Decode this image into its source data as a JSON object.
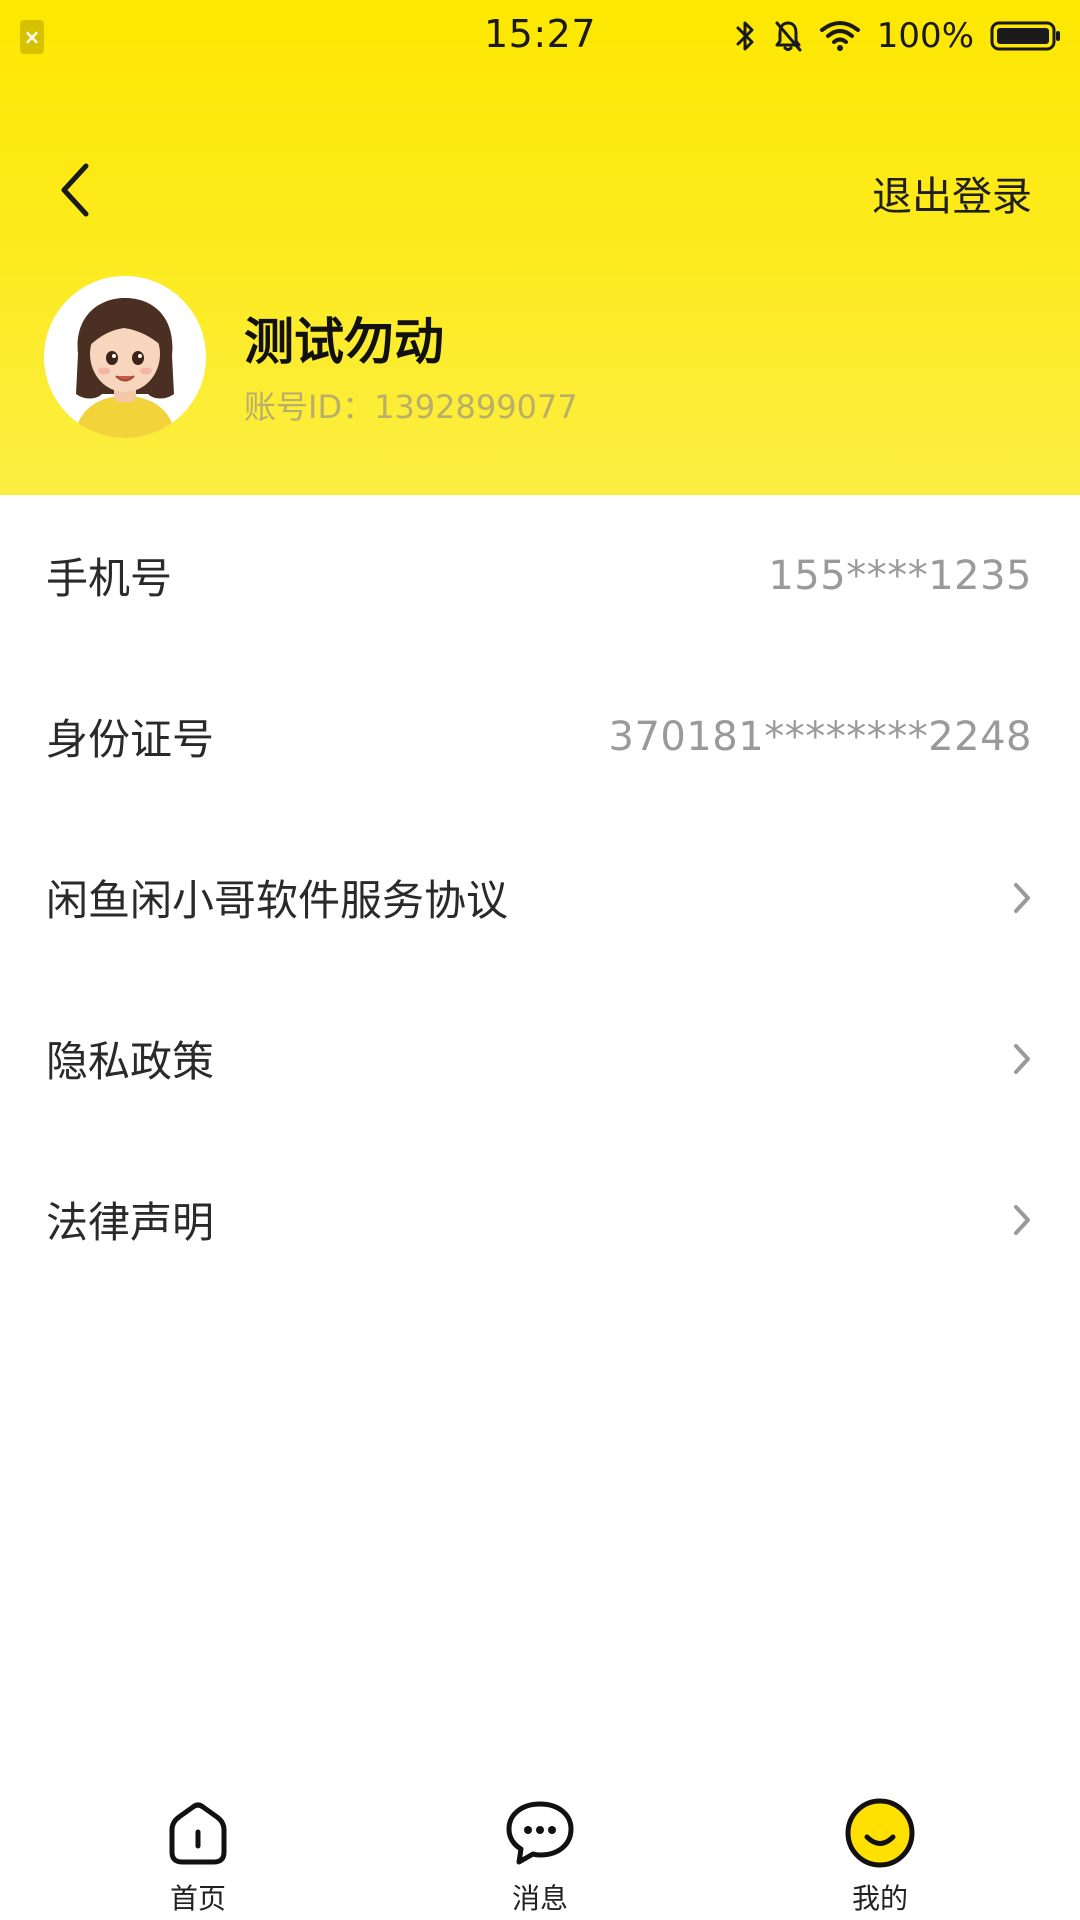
{
  "status_bar": {
    "time": "15:27",
    "battery_text": "100%",
    "icons": [
      "sim-error-icon",
      "bluetooth-icon",
      "bell-muted-icon",
      "wifi-icon",
      "battery-icon"
    ]
  },
  "header": {
    "back_icon": "chevron-left-icon",
    "logout_label": "退出登录",
    "background_color": "#fde800"
  },
  "profile": {
    "avatar_icon": "avatar-girl",
    "name": "测试勿动",
    "account_id": "账号ID：1392899077"
  },
  "list": {
    "items": [
      {
        "label": "手机号",
        "value": "155****1235",
        "chevron": false
      },
      {
        "label": "身份证号",
        "value": "370181********2248",
        "chevron": false
      },
      {
        "label": "闲鱼闲小哥软件服务协议",
        "value": "",
        "chevron": true
      },
      {
        "label": "隐私政策",
        "value": "",
        "chevron": true
      },
      {
        "label": "法律声明",
        "value": "",
        "chevron": true
      }
    ]
  },
  "tabbar": {
    "items": [
      {
        "label": "首页",
        "icon": "home-icon",
        "active": false
      },
      {
        "label": "消息",
        "icon": "message-icon",
        "active": false
      },
      {
        "label": "我的",
        "icon": "smile-icon",
        "active": true
      }
    ],
    "active_color": "#ffe000"
  }
}
